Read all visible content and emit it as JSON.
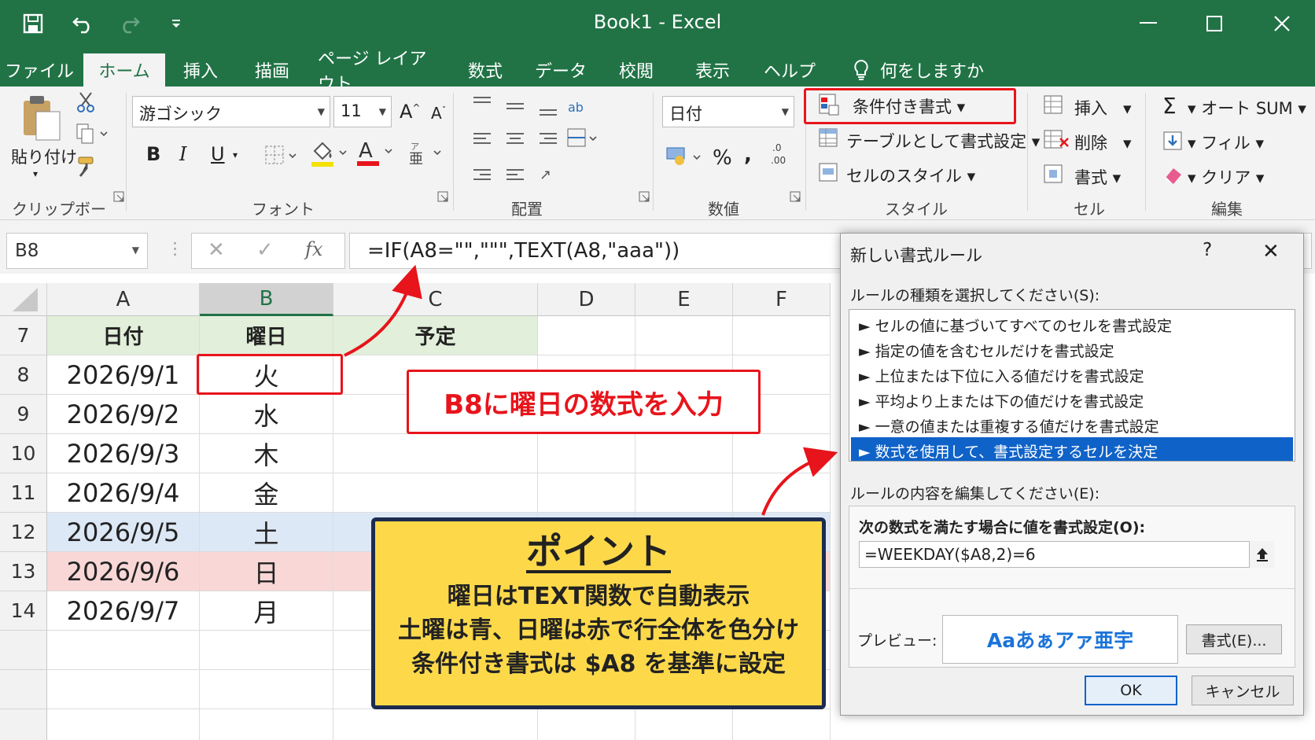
{
  "window": {
    "title": "Book1 - Excel"
  },
  "tabs": [
    "ファイル",
    "ホーム",
    "挿入",
    "描画",
    "ページ レイアウト",
    "数式",
    "データ",
    "校閲",
    "表示",
    "ヘルプ"
  ],
  "tellme": "何をしますか",
  "ribbon": {
    "clipboard": {
      "paste": "貼り付け",
      "label": "クリップボード"
    },
    "font": {
      "name": "游ゴシック",
      "size": "11",
      "label": "フォント"
    },
    "alignment": {
      "label": "配置"
    },
    "number": {
      "format": "日付",
      "percent": "%",
      "comma": ",",
      "decimal": ".0 .00",
      "label": "数値"
    },
    "styles": {
      "conditional": "条件付き書式",
      "table": "テーブルとして書式設定",
      "cell_styles": "セルのスタイル",
      "label": "スタイル"
    },
    "cells": {
      "insert": "挿入",
      "delete": "削除",
      "format": "書式",
      "label": "セル"
    },
    "editing": {
      "autosum": "オート SUM",
      "fill": "フィル",
      "clear": "クリア",
      "label": "編集"
    }
  },
  "formula_bar": {
    "name_box": "B8",
    "fx": "fx",
    "formula": "=IF(A8=\"\",\"\"\",TEXT(A8,\"aaa\"))"
  },
  "columns": [
    "A",
    "B",
    "C",
    "D",
    "E",
    "F"
  ],
  "rows": [
    {
      "num": "7",
      "a": "日付",
      "b": "曜日",
      "c": "予定",
      "style": "hdr"
    },
    {
      "num": "8",
      "a": "2026/9/1",
      "b": "火",
      "c": "",
      "style": ""
    },
    {
      "num": "9",
      "a": "2026/9/2",
      "b": "水",
      "c": "",
      "style": ""
    },
    {
      "num": "10",
      "a": "2026/9/3",
      "b": "木",
      "c": "",
      "style": ""
    },
    {
      "num": "11",
      "a": "2026/9/4",
      "b": "金",
      "c": "",
      "style": ""
    },
    {
      "num": "12",
      "a": "2026/9/5",
      "b": "土",
      "c": "",
      "style": "sat"
    },
    {
      "num": "13",
      "a": "2026/9/6",
      "b": "日",
      "c": "",
      "style": "sun"
    },
    {
      "num": "14",
      "a": "2026/9/7",
      "b": "月",
      "c": "",
      "style": ""
    }
  ],
  "callout": "B8に曜日の数式を入力",
  "point": {
    "title": "ポイント",
    "lines": [
      "曜日はTEXT関数で自動表示",
      "土曜は青、日曜は赤で行全体を色分け",
      "条件付き書式は $A8 を基準に設定"
    ]
  },
  "dialog": {
    "title": "新しい書式ルール",
    "help": "?",
    "close": "✕",
    "rule_type_label": "ルールの種類を選択してください(S):",
    "rules": [
      "► セルの値に基づいてすべてのセルを書式設定",
      "► 指定の値を含むセルだけを書式設定",
      "► 上位または下位に入る値だけを書式設定",
      "► 平均より上または下の値だけを書式設定",
      "► 一意の値または重複する値だけを書式設定",
      "► 数式を使用して、書式設定するセルを決定"
    ],
    "selected_rule": 5,
    "edit_label": "ルールの内容を編集してください(E):",
    "formula_label": "次の数式を満たす場合に値を書式設定(O):",
    "formula": "=WEEKDAY($A8,2)=6",
    "preview_label": "プレビュー:",
    "preview_text": "Aaあぁアァ亜宇",
    "format_button": "書式(E)...",
    "ok": "OK",
    "cancel": "キャンセル"
  },
  "colors": {
    "excel_green": "#217346",
    "accent_red": "#e8141b",
    "point_yellow": "#fdd94a",
    "select_blue": "#0f62c8"
  }
}
